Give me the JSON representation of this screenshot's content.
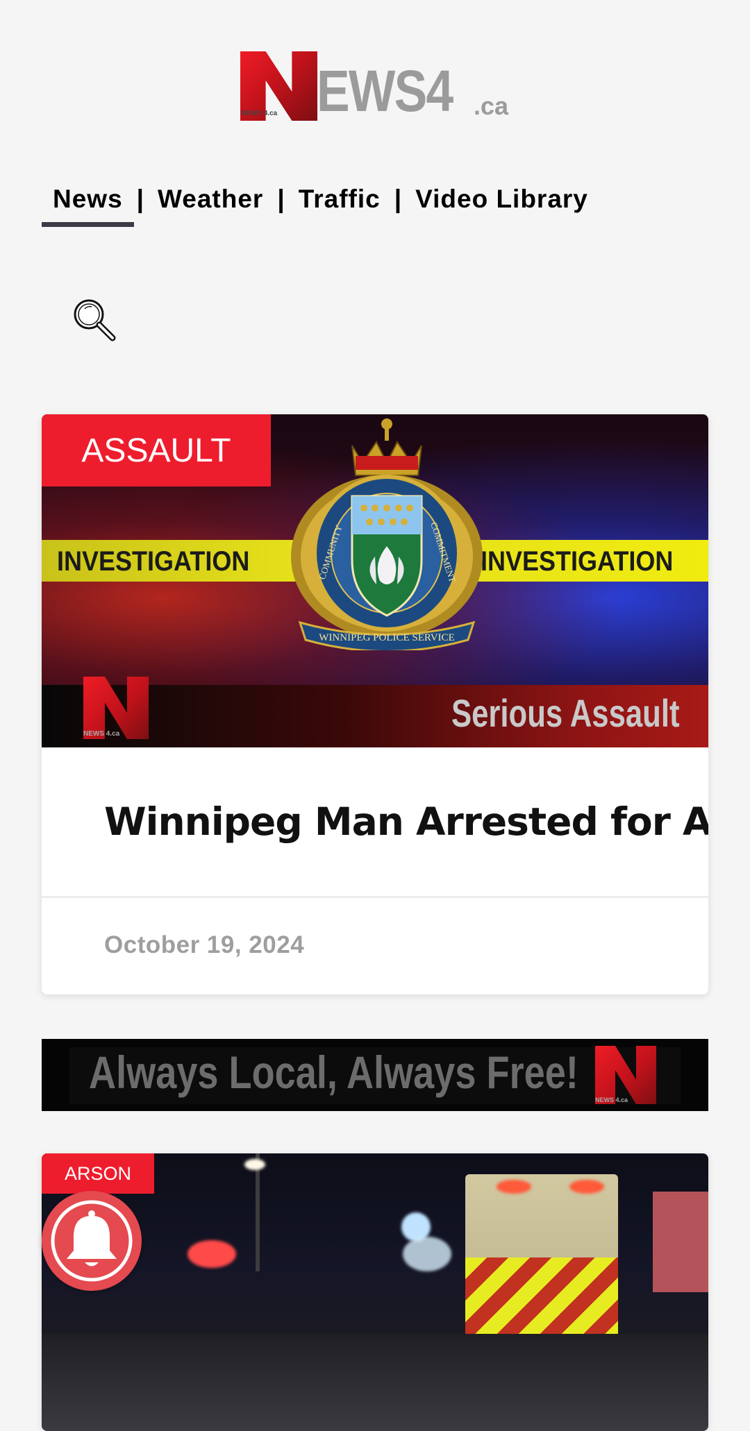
{
  "logo": {
    "mark": "N",
    "word": "EWS4",
    "tld": ".ca",
    "sub": "NEWS 4.ca"
  },
  "nav": {
    "items": [
      {
        "label": "News",
        "active": true
      },
      {
        "label": "Weather",
        "active": false
      },
      {
        "label": "Traffic",
        "active": false
      },
      {
        "label": "Video Library",
        "active": false
      }
    ],
    "separator": "|"
  },
  "search": {
    "icon": "search-icon"
  },
  "articles": [
    {
      "category": "ASSAULT",
      "image": {
        "tape_text": "INVESTIGATION",
        "caption": "Serious Assault",
        "crest_text_left": "COMMUNITY",
        "crest_text_right": "COMMITMENT",
        "crest_ribbon": "WINNIPEG POLICE SERVICE",
        "watermark": "NEWS 4.ca"
      },
      "title": "Winnipeg Man Arrested for Assault",
      "date": "October 19, 2024"
    },
    {
      "category": "ARSON"
    }
  ],
  "banner": {
    "text": "Always Local, Always Free!",
    "watermark": "NEWS 4.ca"
  },
  "colors": {
    "brand_red": "#ee1d2e",
    "nav_underline": "#3b3b46",
    "bell": "#e44a4f",
    "logo_gray": "#9b9b9b",
    "date_gray": "#9e9e9e"
  },
  "notification": {
    "icon": "bell-icon"
  }
}
